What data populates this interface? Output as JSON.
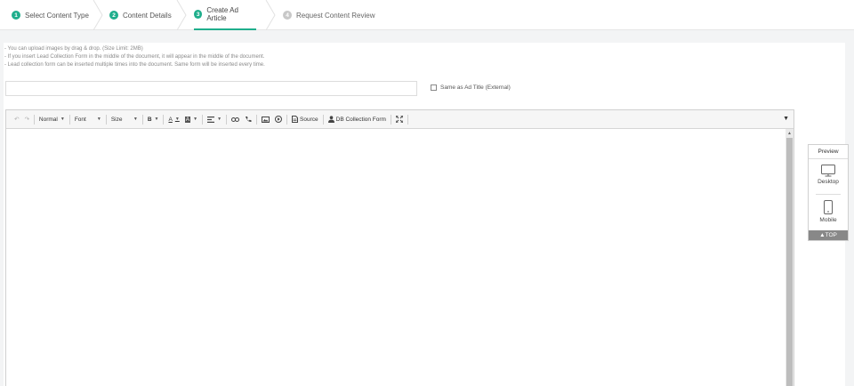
{
  "steps": [
    {
      "num": "1",
      "label": "Select Content Type",
      "state": "done"
    },
    {
      "num": "2",
      "label": "Content Details",
      "state": "done"
    },
    {
      "num": "3",
      "label": "Create Ad Article",
      "state": "active"
    },
    {
      "num": "4",
      "label": "Request Content Review",
      "state": "pending"
    }
  ],
  "notes": [
    "- You can upload images by drag & drop. (Size Limit: 2MB)",
    "- If you insert Lead Collection Form in the middle of the document, it will appear in the middle of the document.",
    "- Lead collection form can be inserted multiple times into the document. Same form will be inserted every time."
  ],
  "title_input": {
    "value": "",
    "placeholder": ""
  },
  "same_as_title": {
    "label": "Same as Ad Title (External)",
    "checked": false
  },
  "toolbar": {
    "format": "Normal",
    "font": "Font",
    "size": "Size",
    "bold": "B",
    "text_color": "A",
    "bg_color": "A",
    "source": "Source",
    "db_form": "DB Collection Form"
  },
  "preview": {
    "title": "Preview",
    "desktop": "Desktop",
    "mobile": "Mobile",
    "top": "▲TOP"
  },
  "colors": {
    "accent": "#1fae8c",
    "inactive": "#c8c8c8"
  }
}
